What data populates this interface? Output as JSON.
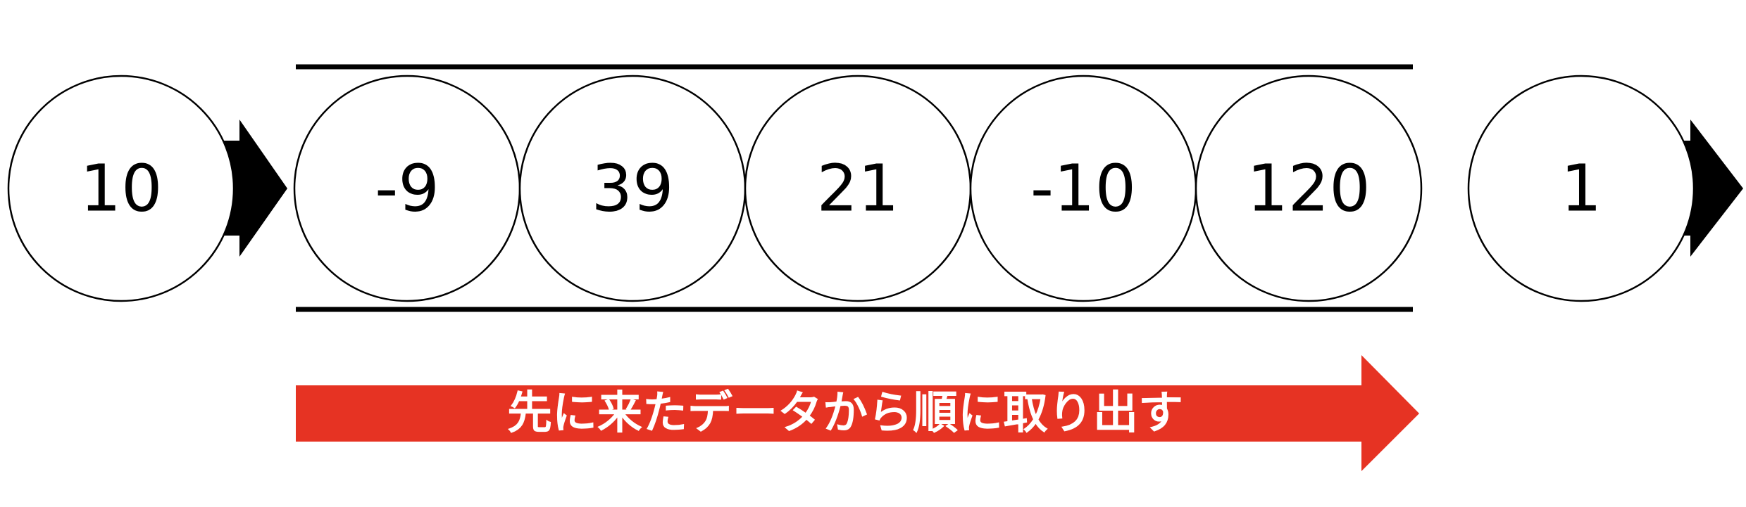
{
  "incoming": {
    "value": "10"
  },
  "queue": {
    "items": [
      "-9",
      "39",
      "21",
      "-10",
      "120"
    ]
  },
  "outgoing": {
    "value": "1"
  },
  "direction_arrow": {
    "label": "先に来たデータから順に取り出す",
    "color": "#e63323"
  },
  "colors": {
    "stroke": "#000000",
    "fill": "#ffffff",
    "label_text": "#ffffff"
  }
}
